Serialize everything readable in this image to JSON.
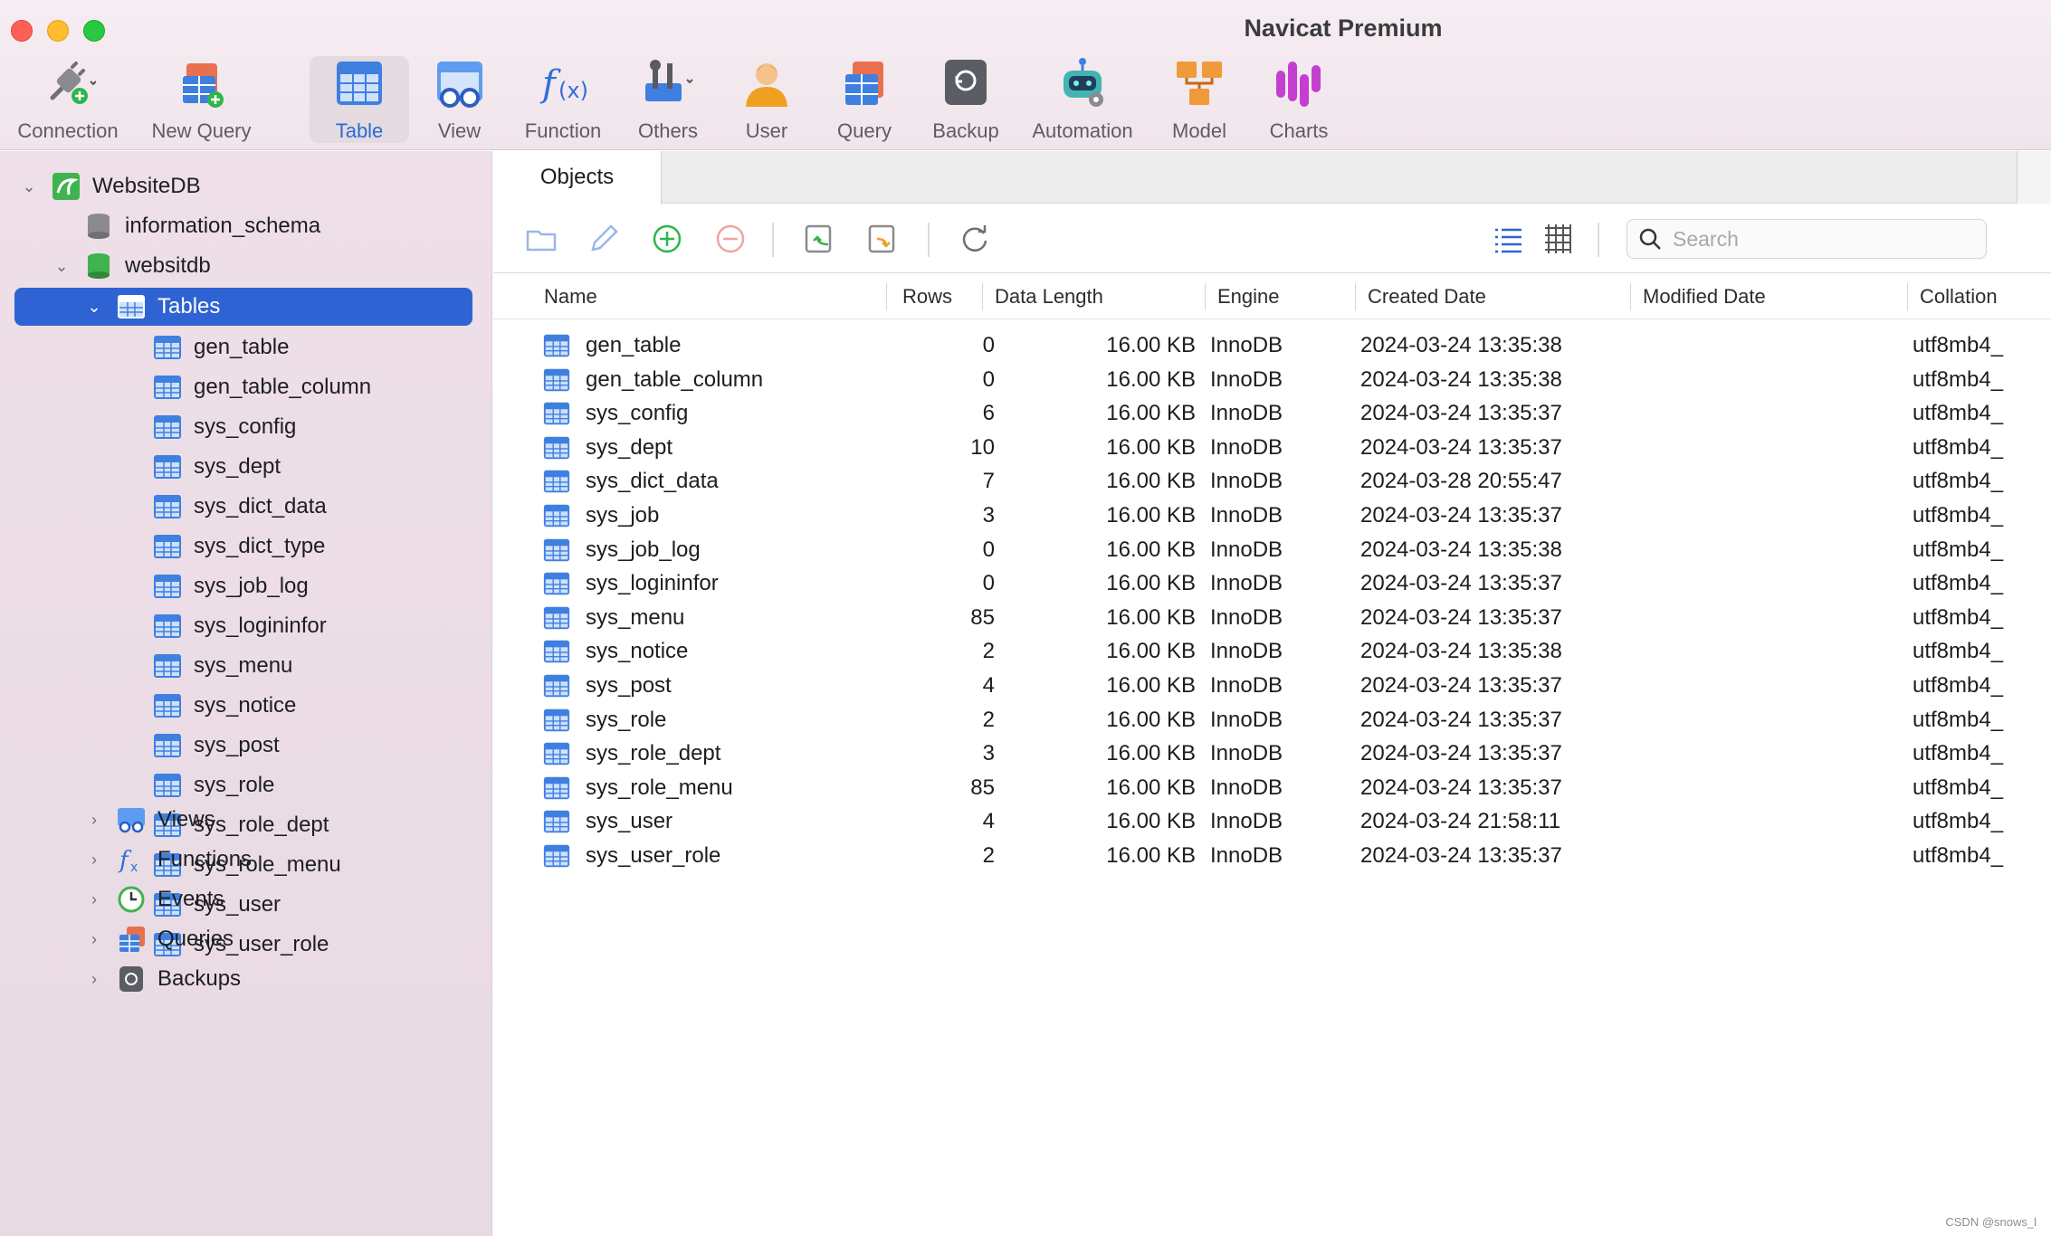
{
  "window": {
    "title": "Navicat Premium"
  },
  "toolbar": {
    "items": [
      {
        "label": "Connection",
        "icon": "connection-plug-icon"
      },
      {
        "label": "New Query",
        "icon": "new-query-icon"
      },
      {
        "label": "Table",
        "icon": "table-icon",
        "active": true
      },
      {
        "label": "View",
        "icon": "view-glasses-icon"
      },
      {
        "label": "Function",
        "icon": "function-fx-icon"
      },
      {
        "label": "Others",
        "icon": "tools-icon"
      },
      {
        "label": "User",
        "icon": "user-icon"
      },
      {
        "label": "Query",
        "icon": "query-icon"
      },
      {
        "label": "Backup",
        "icon": "backup-icon"
      },
      {
        "label": "Automation",
        "icon": "robot-icon"
      },
      {
        "label": "Model",
        "icon": "model-icon"
      },
      {
        "label": "Charts",
        "icon": "charts-icon"
      }
    ]
  },
  "sidebar": {
    "connection": "WebsiteDB",
    "schemas": [
      "information_schema",
      "websitdb"
    ],
    "tables_label": "Tables",
    "tables": [
      "gen_table",
      "gen_table_column",
      "sys_config",
      "sys_dept",
      "sys_dict_data",
      "sys_dict_type",
      "sys_job_log",
      "sys_logininfor",
      "sys_menu",
      "sys_notice",
      "sys_post",
      "sys_role",
      "sys_role_dept",
      "sys_role_menu",
      "sys_user",
      "sys_user_role"
    ],
    "groups": [
      "Views",
      "Functions",
      "Events",
      "Queries",
      "Backups"
    ]
  },
  "main": {
    "tab": "Objects",
    "search_placeholder": "Search",
    "columns": [
      "Name",
      "Rows",
      "Data Length",
      "Engine",
      "Created Date",
      "Modified Date",
      "Collation"
    ],
    "rows": [
      {
        "name": "gen_table",
        "rows": "0",
        "data_length": "16.00 KB",
        "engine": "InnoDB",
        "created": "2024-03-24 13:35:38",
        "modified": "",
        "collation": "utf8mb4_"
      },
      {
        "name": "gen_table_column",
        "rows": "0",
        "data_length": "16.00 KB",
        "engine": "InnoDB",
        "created": "2024-03-24 13:35:38",
        "modified": "",
        "collation": "utf8mb4_"
      },
      {
        "name": "sys_config",
        "rows": "6",
        "data_length": "16.00 KB",
        "engine": "InnoDB",
        "created": "2024-03-24 13:35:37",
        "modified": "",
        "collation": "utf8mb4_"
      },
      {
        "name": "sys_dept",
        "rows": "10",
        "data_length": "16.00 KB",
        "engine": "InnoDB",
        "created": "2024-03-24 13:35:37",
        "modified": "",
        "collation": "utf8mb4_"
      },
      {
        "name": "sys_dict_data",
        "rows": "7",
        "data_length": "16.00 KB",
        "engine": "InnoDB",
        "created": "2024-03-28 20:55:47",
        "modified": "",
        "collation": "utf8mb4_"
      },
      {
        "name": "sys_job",
        "rows": "3",
        "data_length": "16.00 KB",
        "engine": "InnoDB",
        "created": "2024-03-24 13:35:37",
        "modified": "",
        "collation": "utf8mb4_"
      },
      {
        "name": "sys_job_log",
        "rows": "0",
        "data_length": "16.00 KB",
        "engine": "InnoDB",
        "created": "2024-03-24 13:35:38",
        "modified": "",
        "collation": "utf8mb4_"
      },
      {
        "name": "sys_logininfor",
        "rows": "0",
        "data_length": "16.00 KB",
        "engine": "InnoDB",
        "created": "2024-03-24 13:35:37",
        "modified": "",
        "collation": "utf8mb4_"
      },
      {
        "name": "sys_menu",
        "rows": "85",
        "data_length": "16.00 KB",
        "engine": "InnoDB",
        "created": "2024-03-24 13:35:37",
        "modified": "",
        "collation": "utf8mb4_"
      },
      {
        "name": "sys_notice",
        "rows": "2",
        "data_length": "16.00 KB",
        "engine": "InnoDB",
        "created": "2024-03-24 13:35:38",
        "modified": "",
        "collation": "utf8mb4_"
      },
      {
        "name": "sys_post",
        "rows": "4",
        "data_length": "16.00 KB",
        "engine": "InnoDB",
        "created": "2024-03-24 13:35:37",
        "modified": "",
        "collation": "utf8mb4_"
      },
      {
        "name": "sys_role",
        "rows": "2",
        "data_length": "16.00 KB",
        "engine": "InnoDB",
        "created": "2024-03-24 13:35:37",
        "modified": "",
        "collation": "utf8mb4_"
      },
      {
        "name": "sys_role_dept",
        "rows": "3",
        "data_length": "16.00 KB",
        "engine": "InnoDB",
        "created": "2024-03-24 13:35:37",
        "modified": "",
        "collation": "utf8mb4_"
      },
      {
        "name": "sys_role_menu",
        "rows": "85",
        "data_length": "16.00 KB",
        "engine": "InnoDB",
        "created": "2024-03-24 13:35:37",
        "modified": "",
        "collation": "utf8mb4_"
      },
      {
        "name": "sys_user",
        "rows": "4",
        "data_length": "16.00 KB",
        "engine": "InnoDB",
        "created": "2024-03-24 21:58:11",
        "modified": "",
        "collation": "utf8mb4_"
      },
      {
        "name": "sys_user_role",
        "rows": "2",
        "data_length": "16.00 KB",
        "engine": "InnoDB",
        "created": "2024-03-24 13:35:37",
        "modified": "",
        "collation": "utf8mb4_"
      }
    ]
  },
  "watermark": "CSDN @snows_l",
  "colors": {
    "accent": "#2f63d3",
    "sidebar_bg": "#eedfe8",
    "toolbar_bg": "#f6edf2"
  }
}
